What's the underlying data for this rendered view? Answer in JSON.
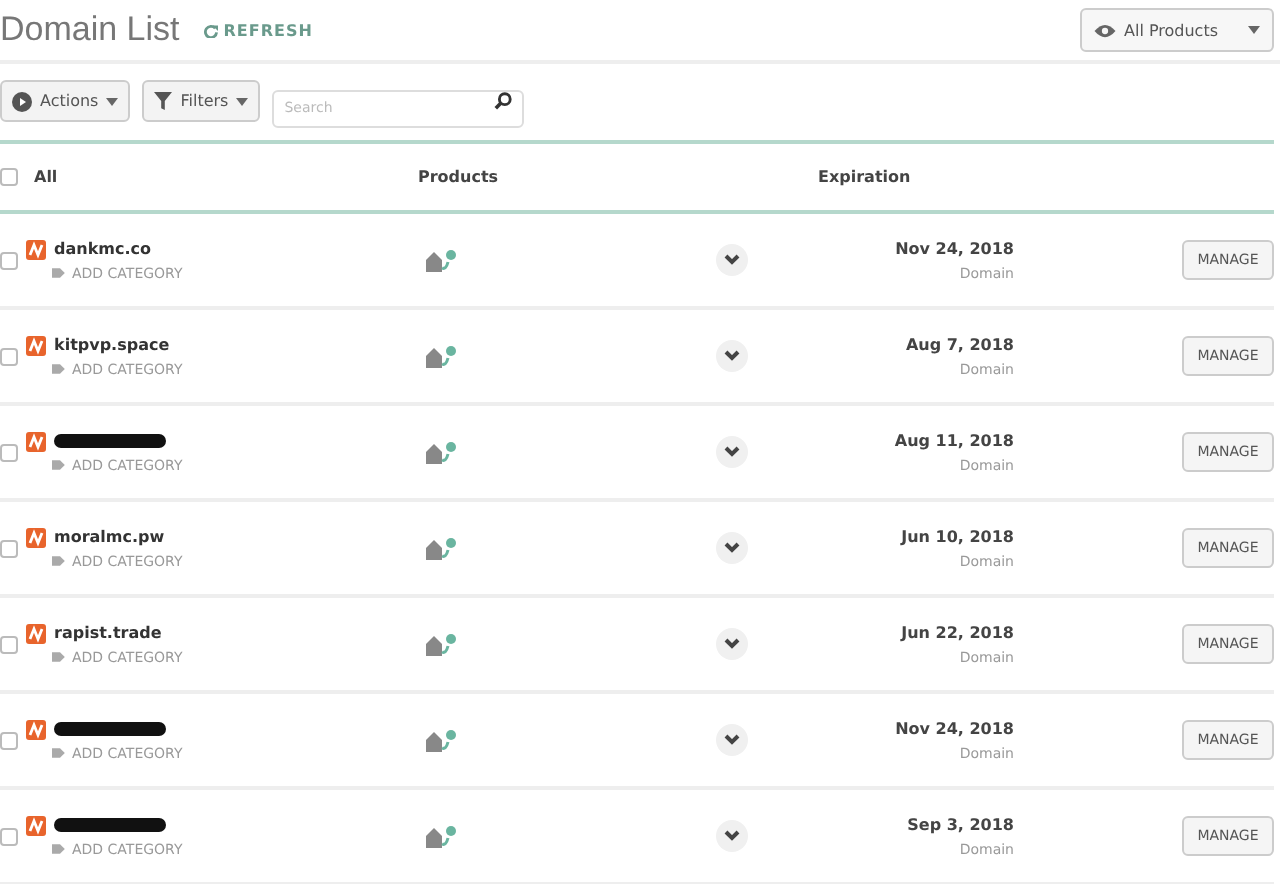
{
  "header": {
    "title": "Domain List",
    "refresh": "REFRESH",
    "product_filter": "All Products"
  },
  "toolbar": {
    "actions": "Actions",
    "filters": "Filters",
    "search": {
      "placeholder": "Search"
    }
  },
  "table": {
    "select_all": {
      "label": "All",
      "checked": false
    },
    "columns": [
      "Products",
      "Expiration"
    ],
    "rows": [
      {
        "name": "dankmc.co",
        "redacted": false,
        "checked": false,
        "category": "ADD CATEGORY",
        "date": "Nov 24, 2018",
        "type": "Domain",
        "action": "MANAGE"
      },
      {
        "name": "kitpvp.space",
        "redacted": false,
        "checked": false,
        "category": "ADD CATEGORY",
        "date": "Aug 7, 2018",
        "type": "Domain",
        "action": "MANAGE"
      },
      {
        "redacted": true,
        "checked": false,
        "category": "ADD CATEGORY",
        "date": "Aug 11, 2018",
        "type": "Domain",
        "action": "MANAGE"
      },
      {
        "name": "moralmc.pw",
        "redacted": false,
        "checked": false,
        "category": "ADD CATEGORY",
        "date": "Jun 10, 2018",
        "type": "Domain",
        "action": "MANAGE"
      },
      {
        "name": "rapist.trade",
        "redacted": false,
        "checked": false,
        "category": "ADD CATEGORY",
        "date": "Jun 22, 2018",
        "type": "Domain",
        "action": "MANAGE"
      },
      {
        "redacted": true,
        "checked": false,
        "category": "ADD CATEGORY",
        "date": "Nov 24, 2018",
        "type": "Domain",
        "action": "MANAGE"
      },
      {
        "redacted": true,
        "checked": false,
        "category": "ADD CATEGORY",
        "date": "Sep 3, 2018",
        "type": "Domain",
        "action": "MANAGE"
      }
    ]
  }
}
